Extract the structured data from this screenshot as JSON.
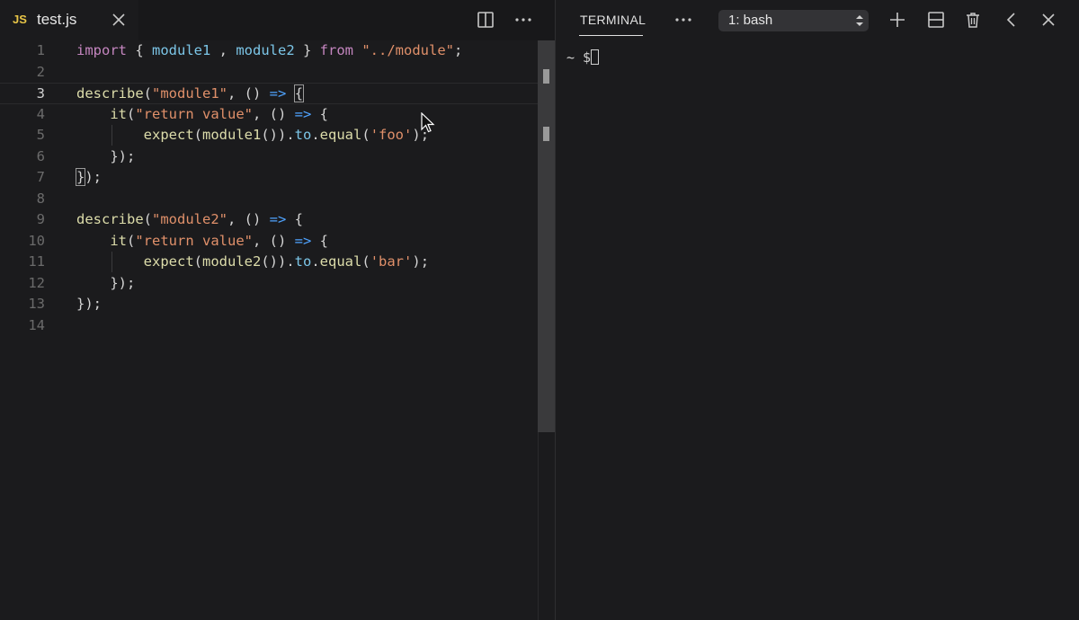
{
  "editor": {
    "tab": {
      "icon_label": "JS",
      "filename": "test.js"
    },
    "lines": [
      {
        "n": "1"
      },
      {
        "n": "2"
      },
      {
        "n": "3"
      },
      {
        "n": "4"
      },
      {
        "n": "5"
      },
      {
        "n": "6"
      },
      {
        "n": "7"
      },
      {
        "n": "8"
      },
      {
        "n": "9"
      },
      {
        "n": "10"
      },
      {
        "n": "11"
      },
      {
        "n": "12"
      },
      {
        "n": "13"
      },
      {
        "n": "14"
      }
    ],
    "code": {
      "l1": [
        "import",
        " { ",
        "module1",
        " , ",
        "module2",
        " } ",
        "from",
        " ",
        "\"../module\"",
        ";"
      ],
      "l3": [
        "describe",
        "(",
        "\"module1\"",
        ", () ",
        "=>",
        " ",
        "{"
      ],
      "l4": [
        "    ",
        "it",
        "(",
        "\"return value\"",
        ", () ",
        "=>",
        " {"
      ],
      "l5": [
        "        ",
        "expect",
        "(",
        "module1",
        "()).",
        "to",
        ".",
        "equal",
        "(",
        "'foo'",
        ");"
      ],
      "l6": [
        "    });"
      ],
      "l7": [
        "}",
        ");"
      ],
      "l9": [
        "describe",
        "(",
        "\"module2\"",
        ", () ",
        "=>",
        " {"
      ],
      "l10": [
        "    ",
        "it",
        "(",
        "\"return value\"",
        ", () ",
        "=>",
        " {"
      ],
      "l11": [
        "        ",
        "expect",
        "(",
        "module2",
        "()).",
        "to",
        ".",
        "equal",
        "(",
        "'bar'",
        ");"
      ],
      "l12": [
        "    });"
      ],
      "l13": [
        "});"
      ]
    },
    "active_line": "3"
  },
  "terminal": {
    "title": "TERMINAL",
    "shell_select": "1: bash",
    "prompt": "~ $"
  },
  "icons": {
    "tab_close": "close-icon",
    "split": "split-editor-icon",
    "more": "more-actions-icon",
    "term_more": "more-actions-icon",
    "add": "plus-icon",
    "split_terminal": "split-terminal-icon",
    "trash": "trash-icon",
    "back": "chevron-left-icon",
    "close_panel": "close-icon"
  }
}
